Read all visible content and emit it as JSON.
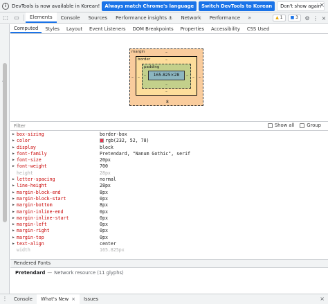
{
  "notification": {
    "message": "DevTools is now available in Korean!",
    "btn_match": "Always match Chrome's language",
    "btn_switch": "Switch DevTools to Korean",
    "btn_dismiss": "Don't show again",
    "close": "×"
  },
  "toolbar": {
    "inspect_icon": "⬚",
    "device_icon": "▭",
    "tabs": [
      "Elements",
      "Console",
      "Sources",
      "Performance insights ⚓",
      "Network",
      "Performance"
    ],
    "more": "»",
    "warnings": "1",
    "info": "3",
    "settings_icon": "⚙",
    "menu_icon": "⋮",
    "close_icon": "×"
  },
  "subtabs": [
    "Computed",
    "Styles",
    "Layout",
    "Event Listeners",
    "DOM Breakpoints",
    "Properties",
    "Accessibility",
    "CSS Used"
  ],
  "boxmodel": {
    "margin_label": "margin",
    "border_label": "border",
    "padding_label": "padding",
    "content": "165.825×28",
    "margin_top": "–",
    "margin_bottom": "8",
    "margin_left": "–",
    "margin_right": "–",
    "border_top": "–",
    "border_bottom": "–",
    "border_left": "–",
    "border_right": "–",
    "padding_top": "–",
    "padding_bottom": "–",
    "padding_left": "–",
    "padding_right": "–"
  },
  "filter": {
    "placeholder": "Filter",
    "show_all": "Show all",
    "group": "Group"
  },
  "properties": [
    {
      "name": "box-sizing",
      "value": "border-box",
      "inherited": false
    },
    {
      "name": "color",
      "value": "rgb(232, 52, 78)",
      "inherited": false,
      "swatch": "#e8344e"
    },
    {
      "name": "display",
      "value": "block",
      "inherited": false
    },
    {
      "name": "font-family",
      "value": "Pretendard, \"Nanum Gothic\", serif",
      "inherited": false
    },
    {
      "name": "font-size",
      "value": "20px",
      "inherited": false
    },
    {
      "name": "font-weight",
      "value": "700",
      "inherited": false
    },
    {
      "name": "height",
      "value": "28px",
      "inherited": true
    },
    {
      "name": "letter-spacing",
      "value": "normal",
      "inherited": false
    },
    {
      "name": "line-height",
      "value": "28px",
      "inherited": false
    },
    {
      "name": "margin-block-end",
      "value": "8px",
      "inherited": false
    },
    {
      "name": "margin-block-start",
      "value": "0px",
      "inherited": false
    },
    {
      "name": "margin-bottom",
      "value": "8px",
      "inherited": false
    },
    {
      "name": "margin-inline-end",
      "value": "0px",
      "inherited": false
    },
    {
      "name": "margin-inline-start",
      "value": "0px",
      "inherited": false
    },
    {
      "name": "margin-left",
      "value": "0px",
      "inherited": false
    },
    {
      "name": "margin-right",
      "value": "0px",
      "inherited": false
    },
    {
      "name": "margin-top",
      "value": "0px",
      "inherited": false
    },
    {
      "name": "text-align",
      "value": "center",
      "inherited": false
    },
    {
      "name": "width",
      "value": "165.825px",
      "inherited": true
    }
  ],
  "rendered_fonts": {
    "header": "Rendered Fonts",
    "font_name": "Pretendard",
    "dash": "—",
    "source": "Network resource (11 glyphs)"
  },
  "drawer": {
    "menu_icon": "⋮",
    "tabs": [
      "Console",
      "What's New",
      "Issues"
    ],
    "close_icon": "×"
  }
}
